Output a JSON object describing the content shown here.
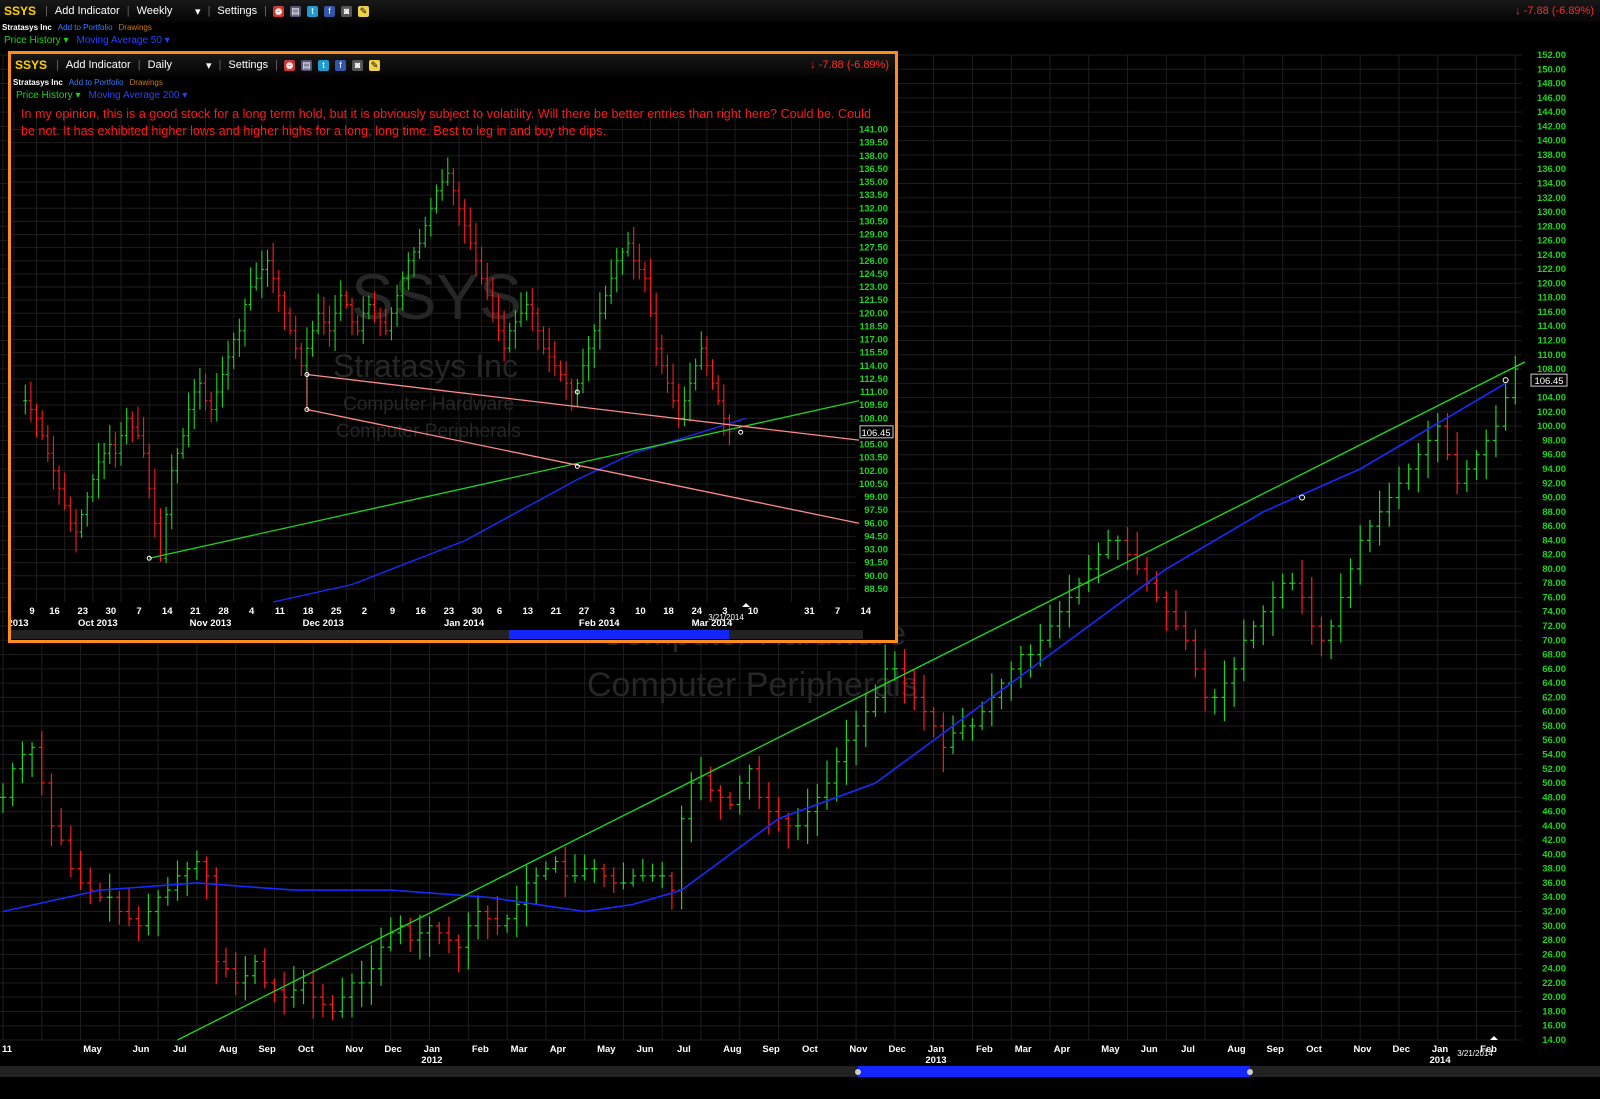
{
  "main": {
    "toolbar": {
      "ticker": "SSYS",
      "add_indicator": "Add Indicator",
      "interval": "Weekly",
      "settings": "Settings",
      "change": "-7.88 (-6.89%)"
    },
    "company": "Stratasys Inc",
    "add_to_portfolio": "Add to Portfolio",
    "drawings": "Drawings",
    "indicator_price": "Price History",
    "indicator_ma": "Moving Average 50",
    "watermark": [
      "SSYS",
      "Stratasys Inc",
      "Computer Hardware",
      "Computer Peripherals"
    ],
    "last_price_tag": "106.45",
    "date_marker": "3/21/2014"
  },
  "inset": {
    "toolbar": {
      "ticker": "SSYS",
      "add_indicator": "Add Indicator",
      "interval": "Daily",
      "settings": "Settings",
      "change": "-7.88 (-6.89%)"
    },
    "company": "Stratasys Inc",
    "add_to_portfolio": "Add to Portfolio",
    "drawings": "Drawings",
    "indicator_price": "Price History",
    "indicator_ma": "Moving Average 200",
    "note": "In my opinion, this is a good stock for a long term hold, but it is obviously subject to volatility.  Will there be better entries than right here?  Could be.  Could be not.  It has exhibited higher lows and higher highs for a long, long time.  Best to leg in and buy the dips.",
    "watermark": [
      "SSYS",
      "Stratasys Inc",
      "Computer Hardware",
      "Computer Peripherals"
    ],
    "last_price_tag": "106.45",
    "date_marker": "3/21/2014"
  },
  "colors": {
    "up": "#1fd21f",
    "down": "#ff1a1a",
    "ma": "#1a2aff",
    "trend": "#1fd21f",
    "channel": "#ff8a8a",
    "axis_text": "#1fd21f",
    "border": "#ff8c1a"
  },
  "chart_data": [
    {
      "type": "ohlc",
      "name": "Weekly",
      "ylim": [
        14,
        152
      ],
      "y_ticks": [
        14,
        16,
        18,
        20,
        22,
        24,
        26,
        28,
        30,
        32,
        34,
        36,
        38,
        40,
        42,
        44,
        46,
        48,
        50,
        52,
        54,
        56,
        58,
        60,
        62,
        64,
        66,
        68,
        70,
        72,
        74,
        76,
        78,
        80,
        82,
        84,
        86,
        88,
        90,
        92,
        94,
        96,
        98,
        100,
        102,
        104,
        106,
        108,
        110,
        112,
        114,
        116,
        118,
        120,
        122,
        124,
        126,
        128,
        130,
        132,
        134,
        136,
        138,
        140,
        142,
        144,
        146,
        148,
        150,
        152
      ],
      "y_tick_labels": [
        "14.00",
        "16.00",
        "18.00",
        "20.00",
        "22.00",
        "24.00",
        "26.00",
        "28.00",
        "30.00",
        "32.00",
        "34.00",
        "36.00",
        "38.00",
        "40.00",
        "42.00",
        "44.00",
        "46.00",
        "48.00",
        "50.00",
        "52.00",
        "54.00",
        "56.00",
        "58.00",
        "60.00",
        "62.00",
        "64.00",
        "66.00",
        "68.00",
        "70.00",
        "72.00",
        "74.00",
        "76.00",
        "78.00",
        "80.00",
        "82.00",
        "84.00",
        "86.00",
        "88.00",
        "90.00",
        "92.00",
        "94.00",
        "96.00",
        "98.00",
        "100.00",
        "102.00",
        "104.00",
        "106.00",
        "108.00",
        "110.00",
        "112.00",
        "114.00",
        "116.00",
        "118.00",
        "120.00",
        "122.00",
        "124.00",
        "126.00",
        "128.00",
        "130.00",
        "132.00",
        "134.00",
        "136.00",
        "138.00",
        "140.00",
        "142.00",
        "144.00",
        "146.00",
        "148.00",
        "150.00",
        "152.00"
      ],
      "x_ticks": [
        {
          "w": 0,
          "label": "11"
        },
        {
          "w": 8,
          "label": "May"
        },
        {
          "w": 13,
          "label": "Jun"
        },
        {
          "w": 17,
          "label": "Jul"
        },
        {
          "w": 22,
          "label": "Aug"
        },
        {
          "w": 26,
          "label": "Sep"
        },
        {
          "w": 30,
          "label": "Oct"
        },
        {
          "w": 35,
          "label": "Nov"
        },
        {
          "w": 39,
          "label": "Dec"
        },
        {
          "w": 43,
          "label": "Jan",
          "year": "2012"
        },
        {
          "w": 48,
          "label": "Feb"
        },
        {
          "w": 52,
          "label": "Mar"
        },
        {
          "w": 56,
          "label": "Apr"
        },
        {
          "w": 61,
          "label": "May"
        },
        {
          "w": 65,
          "label": "Jun"
        },
        {
          "w": 69,
          "label": "Jul"
        },
        {
          "w": 74,
          "label": "Aug"
        },
        {
          "w": 78,
          "label": "Sep"
        },
        {
          "w": 82,
          "label": "Oct"
        },
        {
          "w": 87,
          "label": "Nov"
        },
        {
          "w": 91,
          "label": "Dec"
        },
        {
          "w": 95,
          "label": "Jan",
          "year": "2013"
        },
        {
          "w": 100,
          "label": "Feb"
        },
        {
          "w": 104,
          "label": "Mar"
        },
        {
          "w": 108,
          "label": "Apr"
        },
        {
          "w": 113,
          "label": "May"
        },
        {
          "w": 117,
          "label": "Jun"
        },
        {
          "w": 121,
          "label": "Jul"
        },
        {
          "w": 126,
          "label": "Aug"
        },
        {
          "w": 130,
          "label": "Sep"
        },
        {
          "w": 134,
          "label": "Oct"
        },
        {
          "w": 139,
          "label": "Nov"
        },
        {
          "w": 143,
          "label": "Dec"
        },
        {
          "w": 147,
          "label": "Jan",
          "year": "2014"
        },
        {
          "w": 152,
          "label": "Feb"
        }
      ],
      "weeks": 157,
      "closes": [
        48,
        52,
        54,
        55,
        50,
        44,
        42,
        38,
        36,
        35,
        34,
        34,
        32,
        31,
        30,
        32,
        34,
        35,
        37,
        38,
        39,
        37,
        25,
        24,
        22,
        23,
        25,
        22,
        21,
        20,
        21,
        22,
        20,
        19,
        18,
        20,
        22,
        22,
        24,
        27,
        29,
        30,
        28,
        29,
        30,
        29,
        28,
        27,
        30,
        32,
        31,
        30,
        31,
        33,
        36,
        37,
        38,
        39,
        37,
        37,
        38,
        38,
        37,
        36,
        36,
        37,
        37,
        37,
        37,
        35,
        45,
        50,
        51,
        49,
        48,
        47,
        50,
        52,
        48,
        46,
        45,
        44,
        44,
        46,
        48,
        50,
        53,
        56,
        58,
        60,
        62,
        66,
        66,
        64,
        62,
        60,
        58,
        55,
        57,
        58,
        58,
        60,
        62,
        64,
        66,
        68,
        68,
        70,
        72,
        74,
        76,
        78,
        80,
        82,
        84,
        84,
        82,
        80,
        78,
        76,
        74,
        72,
        70,
        66,
        62,
        62,
        64,
        66,
        70,
        72,
        74,
        76,
        78,
        78,
        76,
        72,
        70,
        72,
        76,
        80,
        84,
        86,
        88,
        90,
        92,
        94,
        96,
        98,
        100,
        96,
        92,
        94,
        96,
        98,
        100,
        104,
        108
      ],
      "ma": [
        [
          0,
          32
        ],
        [
          10,
          35
        ],
        [
          20,
          36
        ],
        [
          30,
          35
        ],
        [
          40,
          35
        ],
        [
          50,
          34
        ],
        [
          60,
          32
        ],
        [
          65,
          33
        ],
        [
          70,
          35
        ],
        [
          80,
          45
        ],
        [
          90,
          50
        ],
        [
          95,
          55
        ],
        [
          100,
          60
        ],
        [
          110,
          70
        ],
        [
          120,
          80
        ],
        [
          130,
          88
        ],
        [
          140,
          94
        ],
        [
          150,
          102
        ],
        [
          155,
          106
        ]
      ],
      "trendline": [
        [
          18,
          14
        ],
        [
          157,
          109
        ]
      ],
      "last": 106.45,
      "last_date": "3/21/2014"
    },
    {
      "type": "ohlc",
      "name": "Daily",
      "ylim": [
        87,
        143
      ],
      "y_ticks": [
        88.5,
        90,
        91.5,
        93,
        94.5,
        96,
        97.5,
        99,
        100.5,
        102,
        103.5,
        105,
        106.5,
        108,
        109.5,
        111,
        112.5,
        114,
        115.5,
        117,
        118.5,
        120,
        121.5,
        123,
        124.5,
        126,
        127.5,
        129,
        130.5,
        132,
        133.5,
        135,
        136.5,
        138,
        139.5,
        141
      ],
      "y_tick_labels": [
        "88.50",
        "90.00",
        "91.50",
        "93.00",
        "94.50",
        "96.00",
        "97.50",
        "99.00",
        "100.50",
        "102.00",
        "103.50",
        "105.00",
        "106.50",
        "108.00",
        "109.50",
        "111.00",
        "112.50",
        "114.00",
        "115.50",
        "117.00",
        "118.50",
        "120.00",
        "121.50",
        "123.00",
        "124.50",
        "126.00",
        "127.50",
        "129.00",
        "130.50",
        "132.00",
        "133.50",
        "135.00",
        "136.50",
        "138.00",
        "139.50",
        "141.00"
      ],
      "x_ticks": [
        {
          "d": 0,
          "label": "9",
          "month": "2013"
        },
        {
          "d": 4,
          "label": "16"
        },
        {
          "d": 9,
          "label": "23"
        },
        {
          "d": 14,
          "label": "30",
          "month": "Oct 2013"
        },
        {
          "d": 19,
          "label": "7"
        },
        {
          "d": 24,
          "label": "14"
        },
        {
          "d": 29,
          "label": "21"
        },
        {
          "d": 34,
          "label": "28",
          "month": "Nov 2013"
        },
        {
          "d": 39,
          "label": "4"
        },
        {
          "d": 44,
          "label": "11"
        },
        {
          "d": 49,
          "label": "18"
        },
        {
          "d": 54,
          "label": "25",
          "month": "Dec 2013"
        },
        {
          "d": 59,
          "label": "2"
        },
        {
          "d": 64,
          "label": "9"
        },
        {
          "d": 69,
          "label": "16"
        },
        {
          "d": 74,
          "label": "23"
        },
        {
          "d": 79,
          "label": "30",
          "month": "Jan 2014"
        },
        {
          "d": 83,
          "label": "6"
        },
        {
          "d": 88,
          "label": "13"
        },
        {
          "d": 93,
          "label": "21"
        },
        {
          "d": 98,
          "label": "27"
        },
        {
          "d": 103,
          "label": "3",
          "month": "Feb 2014"
        },
        {
          "d": 108,
          "label": "10"
        },
        {
          "d": 113,
          "label": "18"
        },
        {
          "d": 118,
          "label": "24"
        },
        {
          "d": 123,
          "label": "3",
          "month": "Mar 2014"
        },
        {
          "d": 128,
          "label": "10"
        },
        {
          "d": 138,
          "label": "31"
        },
        {
          "d": 143,
          "label": "7"
        },
        {
          "d": 148,
          "label": "14"
        }
      ],
      "days": 150,
      "closes": [
        110,
        109,
        108,
        106,
        104,
        102,
        100,
        98,
        96,
        95,
        97,
        99,
        101,
        103,
        104,
        105,
        104,
        106,
        108,
        107,
        106,
        104,
        100,
        96,
        92,
        97,
        102,
        104,
        106,
        109,
        111,
        112,
        110,
        109,
        111,
        113,
        115,
        117,
        118,
        121,
        123,
        124,
        125,
        126,
        124,
        122,
        120,
        118,
        116,
        114,
        116,
        118,
        120,
        119,
        118,
        120,
        122,
        121,
        119,
        118,
        120,
        121,
        120,
        119,
        118,
        120,
        122,
        124,
        126,
        127,
        128,
        130,
        132,
        134,
        135,
        136,
        134,
        132,
        130,
        128,
        126,
        124,
        122,
        120,
        118,
        116,
        118,
        119,
        120,
        121,
        120,
        118,
        116,
        115,
        114,
        113,
        112,
        111,
        112,
        114,
        116,
        118,
        120,
        122,
        124,
        126,
        127,
        128,
        126,
        125,
        124,
        120,
        116,
        114,
        112,
        110,
        108,
        110,
        112,
        114,
        116,
        114,
        112,
        110,
        108,
        106.45
      ],
      "ma": [
        [
          46,
          87
        ],
        [
          60,
          89
        ],
        [
          80,
          94
        ],
        [
          100,
          101
        ],
        [
          110,
          104
        ],
        [
          120,
          106
        ],
        [
          130,
          108
        ]
      ],
      "trendline": [
        [
          24,
          92
        ],
        [
          150,
          110
        ]
      ],
      "channel_upper": [
        [
          52,
          113
        ],
        [
          150,
          105.5
        ]
      ],
      "channel_lower": [
        [
          52,
          109
        ],
        [
          150,
          96
        ]
      ],
      "last": 106.45,
      "last_date": "3/21/2014"
    }
  ]
}
